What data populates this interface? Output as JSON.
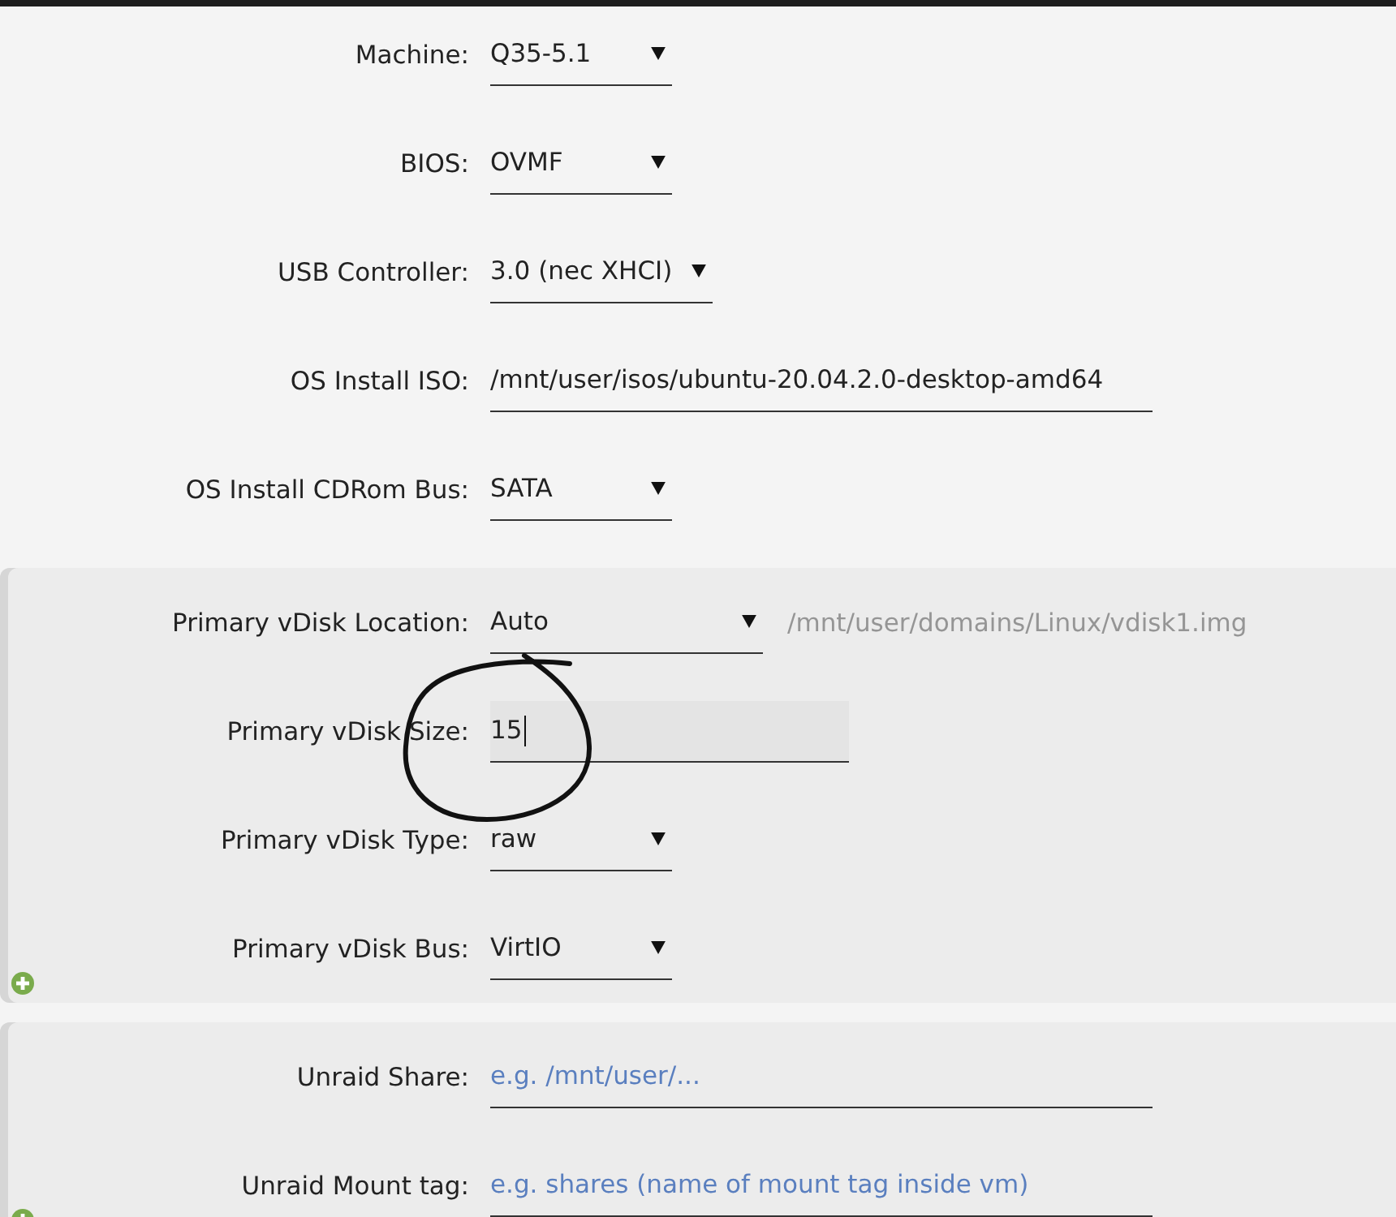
{
  "sections": [
    {
      "kind": "plain",
      "fields": [
        {
          "kind": "select",
          "label": "Machine:",
          "value": "Q35-5.1"
        },
        {
          "kind": "select",
          "label": "BIOS:",
          "value": "OVMF"
        },
        {
          "kind": "select",
          "label": "USB Controller:",
          "value": "3.0 (nec XHCI)"
        },
        {
          "kind": "text",
          "label": "OS Install ISO:",
          "value": "/mnt/user/isos/ubuntu-20.04.2.0-desktop-amd64",
          "focused": false
        },
        {
          "kind": "select",
          "label": "OS Install CDRom Bus:",
          "value": "SATA"
        }
      ]
    },
    {
      "kind": "panel",
      "add_button": true,
      "fields": [
        {
          "kind": "select",
          "label": "Primary vDisk Location:",
          "value": "Auto",
          "hint": "/mnt/user/domains/Linux/vdisk1.img"
        },
        {
          "kind": "number",
          "label": "Primary vDisk Size:",
          "value": "15",
          "focused": true
        },
        {
          "kind": "select",
          "label": "Primary vDisk Type:",
          "value": "raw"
        },
        {
          "kind": "select",
          "label": "Primary vDisk Bus:",
          "value": "VirtIO"
        }
      ]
    },
    {
      "kind": "panel",
      "add_button": true,
      "fields": [
        {
          "kind": "text",
          "label": "Unraid Share:",
          "placeholder": "e.g. /mnt/user/...",
          "focused": false
        },
        {
          "kind": "text",
          "label": "Unraid Mount tag:",
          "placeholder": "e.g. shares (name of mount tag inside vm)",
          "focused": false
        }
      ]
    }
  ],
  "annotations": [
    {
      "kind": "ink-circle"
    }
  ]
}
